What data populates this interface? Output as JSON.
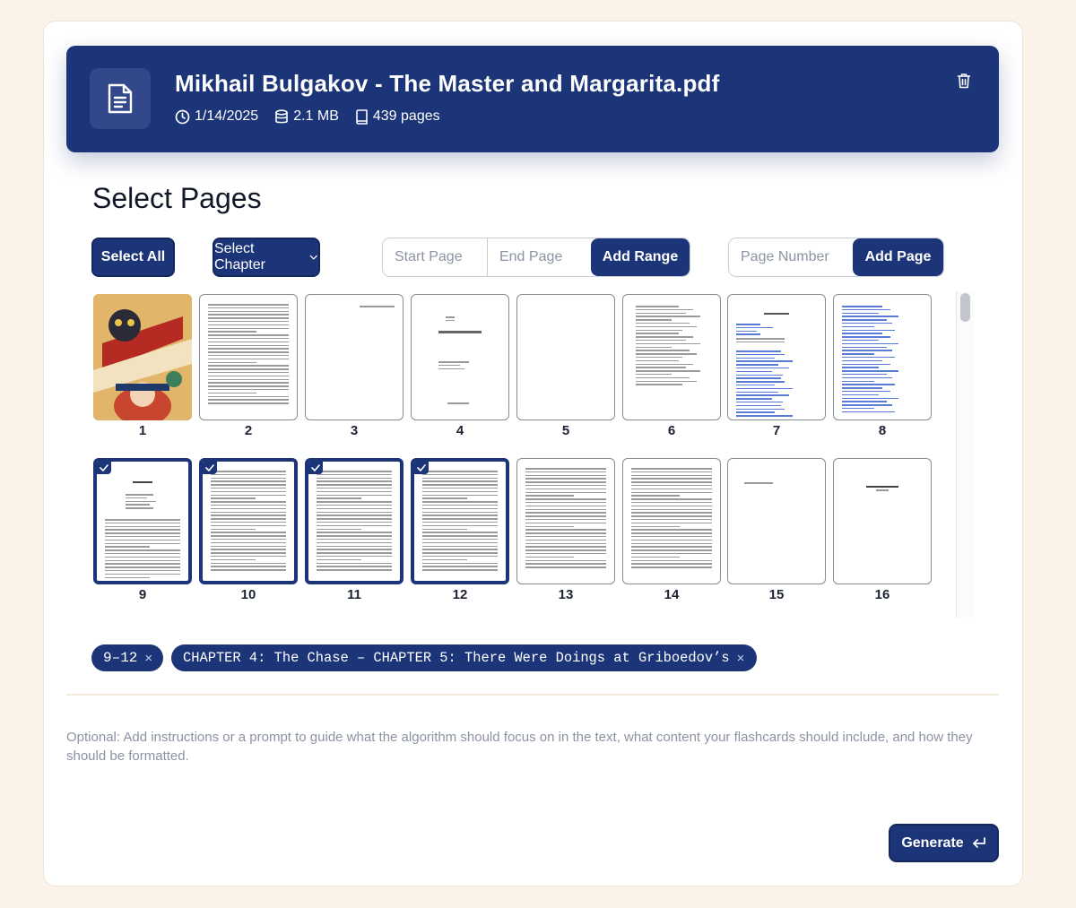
{
  "file": {
    "title": "Mikhail Bulgakov - The Master and Margarita.pdf",
    "date": "1/14/2025",
    "size": "2.1 MB",
    "pages": "439 pages",
    "icons": [
      "document-icon",
      "clock-icon",
      "database-icon",
      "book-icon",
      "trash-icon"
    ]
  },
  "section_title": "Select Pages",
  "controls": {
    "select_all": "Select All",
    "select_chapter": "Select Chapter",
    "start_page_placeholder": "Start Page",
    "end_page_placeholder": "End Page",
    "add_range": "Add Range",
    "page_number_placeholder": "Page Number",
    "add_page": "Add Page"
  },
  "thumbnails": [
    {
      "num": "1",
      "selected": false,
      "kind": "cover"
    },
    {
      "num": "2",
      "selected": false,
      "kind": "text"
    },
    {
      "num": "3",
      "selected": false,
      "kind": "blank"
    },
    {
      "num": "4",
      "selected": false,
      "kind": "title"
    },
    {
      "num": "5",
      "selected": false,
      "kind": "blank"
    },
    {
      "num": "6",
      "selected": false,
      "kind": "copyright"
    },
    {
      "num": "7",
      "selected": false,
      "kind": "contents"
    },
    {
      "num": "8",
      "selected": false,
      "kind": "contents2"
    },
    {
      "num": "9",
      "selected": true,
      "kind": "foreword"
    },
    {
      "num": "10",
      "selected": true,
      "kind": "text"
    },
    {
      "num": "11",
      "selected": true,
      "kind": "text"
    },
    {
      "num": "12",
      "selected": true,
      "kind": "text"
    },
    {
      "num": "13",
      "selected": false,
      "kind": "text"
    },
    {
      "num": "14",
      "selected": false,
      "kind": "text"
    },
    {
      "num": "15",
      "selected": false,
      "kind": "sparse"
    },
    {
      "num": "16",
      "selected": false,
      "kind": "bookone"
    }
  ],
  "tags": [
    {
      "label": "9–12",
      "remove": "×"
    },
    {
      "label": "CHAPTER 4: The Chase – CHAPTER 5: There Were Doings at Griboedov’s",
      "remove": "×"
    }
  ],
  "prompt_placeholder": "Optional: Add instructions or a prompt to guide what the algorithm should focus on in the text, what content your flashcards should include, and how they should be formatted.",
  "generate_label": "Generate",
  "colors": {
    "primary": "#1c3478",
    "background": "#fbf3ea",
    "card": "#ffffff"
  }
}
